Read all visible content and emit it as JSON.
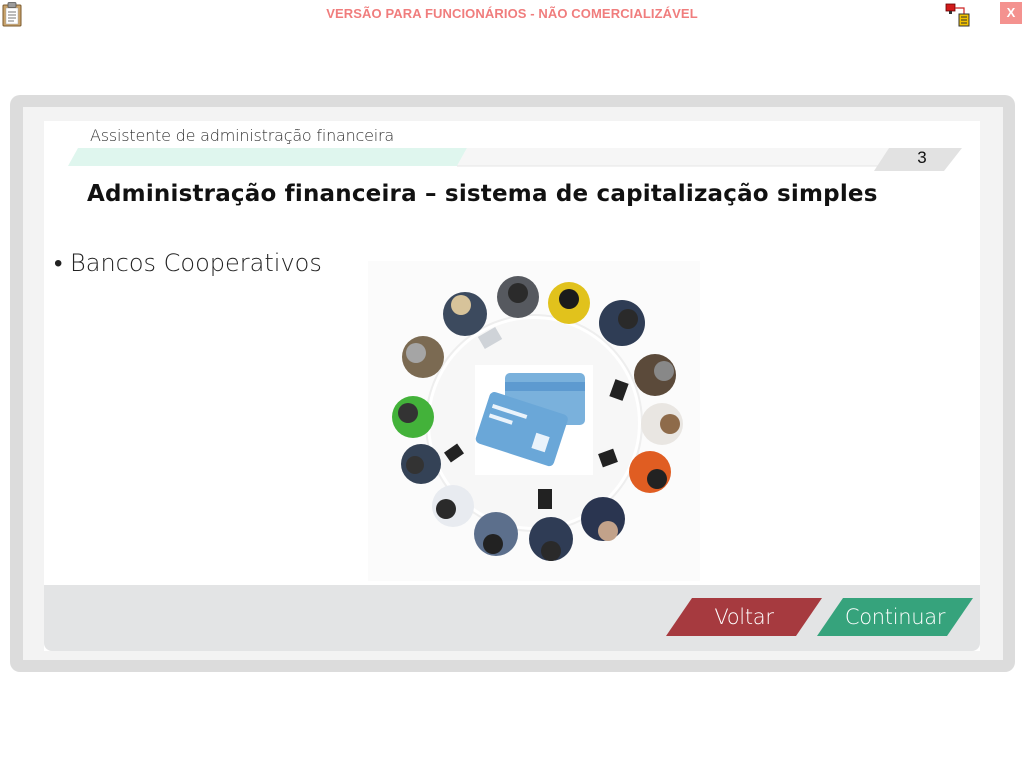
{
  "topbar": {
    "version_notice": "VERSÃO PARA FUNCIONÁRIOS - NÃO COMERCIALIZÁVEL",
    "close_label": "X",
    "left_icon": "clipboard-icon",
    "right_icon": "network-icon"
  },
  "slide": {
    "header": "Assistente de administração financeira",
    "page_number": "3",
    "title": "Administração financeira – sistema de capitalização simples",
    "bullet": "• Bancos Cooperativos",
    "image": "people-around-table-with-credit-cards"
  },
  "nav": {
    "back_label": "Voltar",
    "continue_label": "Continuar"
  },
  "colors": {
    "notice": "#f07d7d",
    "close": "#f4928f",
    "back_button": "#a63a3f",
    "continue_button": "#36a37c",
    "header_stripe": "#dff6ee",
    "card": "#6aa7d8"
  }
}
